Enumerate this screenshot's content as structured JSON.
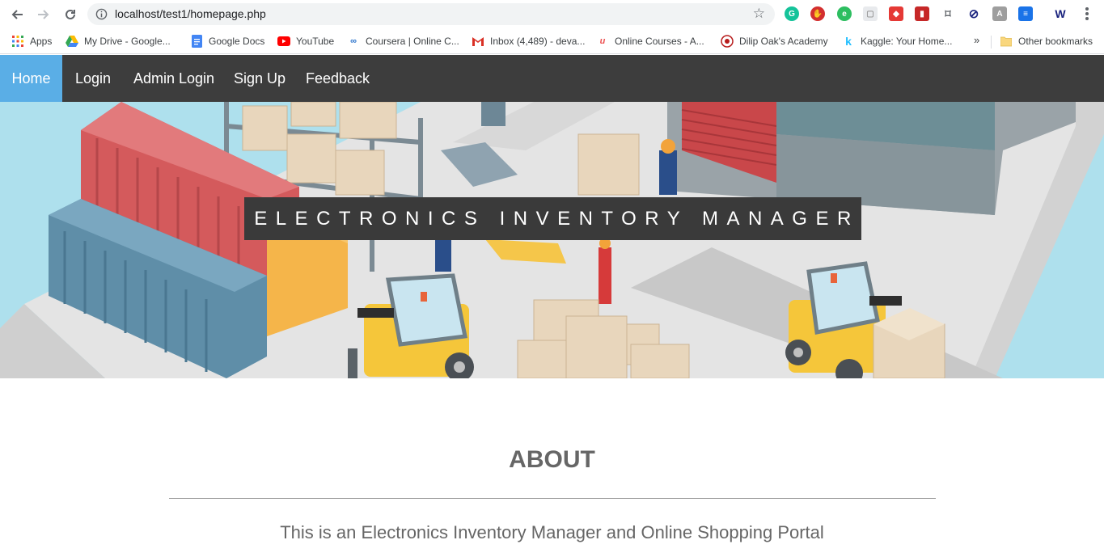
{
  "browser": {
    "url": "localhost/test1/homepage.php",
    "bookmarks": [
      {
        "label": "Apps",
        "icon": "apps-grid-icon"
      },
      {
        "label": "My Drive - Google...",
        "icon": "google-drive-icon"
      },
      {
        "label": "Google Docs",
        "icon": "google-docs-icon"
      },
      {
        "label": "YouTube",
        "icon": "youtube-icon"
      },
      {
        "label": "Coursera | Online C...",
        "icon": "coursera-icon"
      },
      {
        "label": "Inbox (4,489) - deva...",
        "icon": "gmail-icon"
      },
      {
        "label": "Online Courses - A...",
        "icon": "udemy-icon"
      },
      {
        "label": "Dilip Oak's Academy",
        "icon": "academy-icon"
      },
      {
        "label": "Kaggle: Your Home...",
        "icon": "kaggle-icon"
      }
    ],
    "more_bookmarks": "»",
    "other_bookmarks": "Other bookmarks"
  },
  "site": {
    "nav": [
      {
        "label": "Home",
        "active": true
      },
      {
        "label": "Login",
        "active": false
      },
      {
        "label": "Admin Login",
        "active": false
      },
      {
        "label": "Sign Up",
        "active": false
      },
      {
        "label": "Feedback",
        "active": false
      }
    ],
    "hero_title": "ELECTRONICS INVENTORY MANAGER",
    "about_heading": "ABOUT",
    "about_text": "This is an Electronics Inventory Manager and Online Shopping Portal"
  },
  "colors": {
    "nav_bg": "#3d3d3d",
    "nav_active": "#5aaee6",
    "hero_sky": "#aee0ed",
    "title_bg": "#3a3a3a"
  }
}
